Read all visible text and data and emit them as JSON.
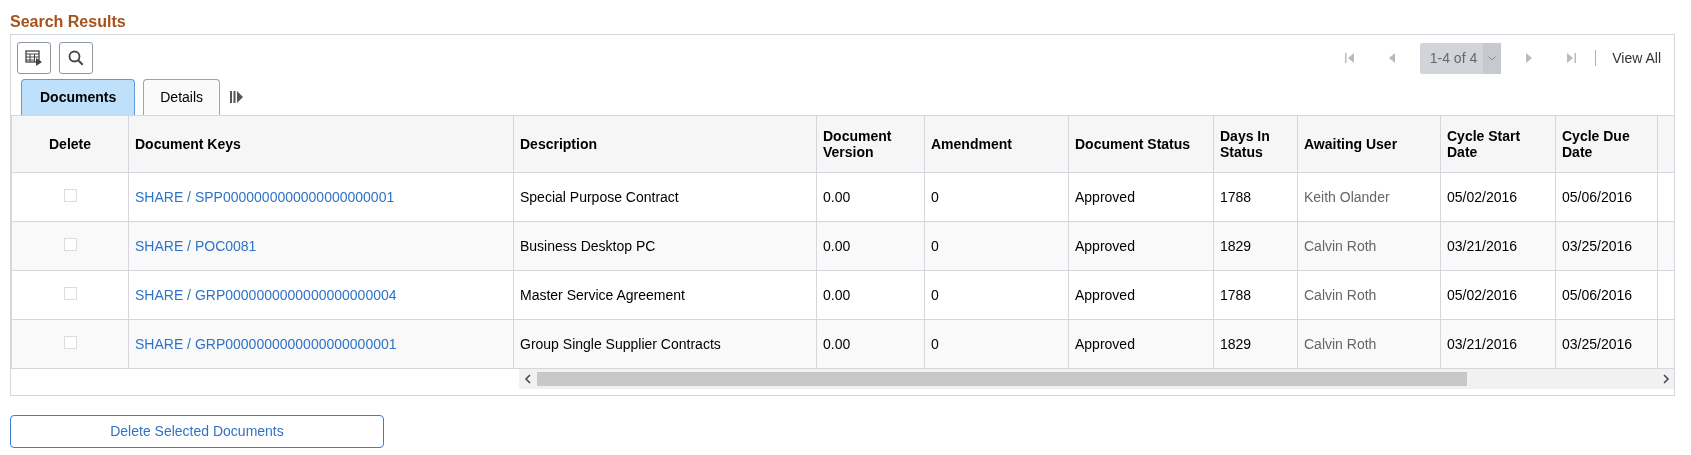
{
  "title": "Search Results",
  "pagination": {
    "range": "1-4 of 4",
    "view_all": "View All",
    "first_disabled": true,
    "prev_disabled": true,
    "next_disabled": true,
    "last_disabled": true
  },
  "tabs": [
    {
      "label": "Documents",
      "selected": true
    },
    {
      "label": "Details",
      "selected": false
    }
  ],
  "columns": [
    {
      "label": "Delete",
      "kind": "check"
    },
    {
      "label": "Document Keys",
      "kind": "link"
    },
    {
      "label": "Description",
      "kind": "text"
    },
    {
      "label": "Document Version",
      "kind": "text"
    },
    {
      "label": "Amendment",
      "kind": "text"
    },
    {
      "label": "Document Status",
      "kind": "text"
    },
    {
      "label": "Days In Status",
      "kind": "text"
    },
    {
      "label": "Awaiting User",
      "kind": "muted"
    },
    {
      "label": "Cycle Start Date",
      "kind": "text"
    },
    {
      "label": "Cycle Due Date",
      "kind": "text"
    }
  ],
  "rows": [
    {
      "checked": false,
      "disabled": true,
      "cells": [
        "SHARE / SPP0000000000000000000001",
        "Special Purpose Contract",
        "0.00",
        "0",
        "Approved",
        "1788",
        "Keith Olander",
        "05/02/2016",
        "05/06/2016"
      ]
    },
    {
      "checked": false,
      "disabled": true,
      "cells": [
        "SHARE / POC0081",
        "Business Desktop PC",
        "0.00",
        "0",
        "Approved",
        "1829",
        "Calvin Roth",
        "03/21/2016",
        "03/25/2016"
      ]
    },
    {
      "checked": false,
      "disabled": true,
      "cells": [
        "SHARE / GRP0000000000000000000004",
        "Master Service Agreement",
        "0.00",
        "0",
        "Approved",
        "1788",
        "Calvin Roth",
        "05/02/2016",
        "05/06/2016"
      ]
    },
    {
      "checked": false,
      "disabled": true,
      "cells": [
        "SHARE / GRP0000000000000000000001",
        "Group Single Supplier Contracts",
        "0.00",
        "0",
        "Approved",
        "1829",
        "Calvin Roth",
        "03/21/2016",
        "03/25/2016"
      ]
    }
  ],
  "action_button": "Delete Selected Documents"
}
